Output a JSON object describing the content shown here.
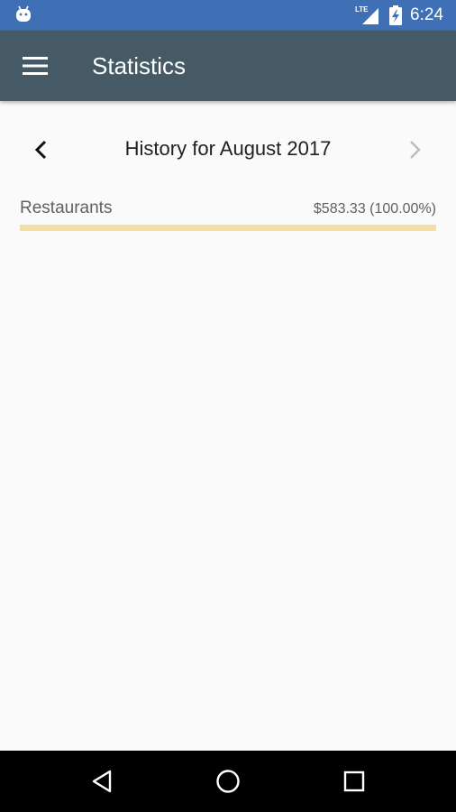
{
  "status_bar": {
    "time": "6:24",
    "network_label": "LTE",
    "icons": [
      "android-icon",
      "lte-signal-icon",
      "battery-charging-icon"
    ]
  },
  "app_bar": {
    "title": "Statistics",
    "menu_icon": "hamburger-menu-icon",
    "color": "#455a64"
  },
  "history": {
    "title": "History for August 2017",
    "prev_icon": "chevron-left-icon",
    "next_icon": "chevron-right-icon",
    "next_enabled": false
  },
  "categories": [
    {
      "name": "Restaurants",
      "amount": "$583.33 (100.00%)",
      "fraction": 1.0,
      "color": "#f3dfa5"
    }
  ],
  "nav_bar": {
    "icons": [
      "back-triangle-icon",
      "home-circle-icon",
      "recents-square-icon"
    ]
  },
  "colors": {
    "status_bar": "#3f6fb5",
    "app_bar": "#455a64",
    "background": "#fafafa"
  }
}
